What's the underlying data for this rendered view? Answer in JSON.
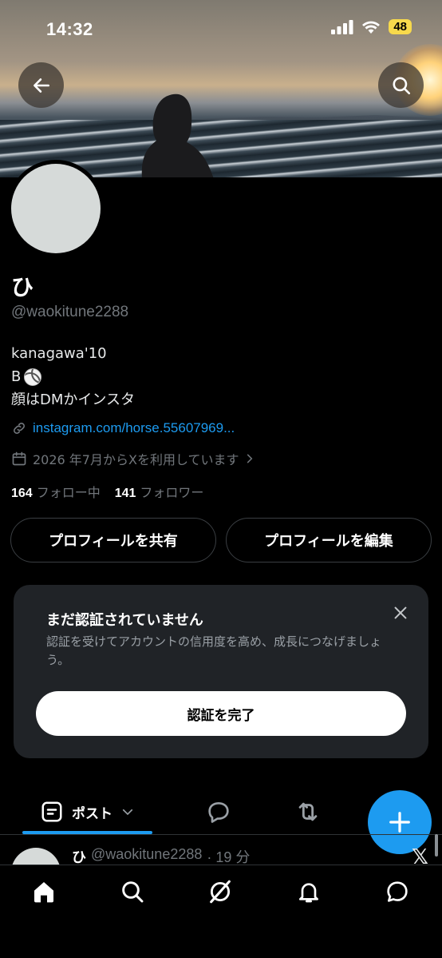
{
  "status_bar": {
    "time": "14:32",
    "battery": "48"
  },
  "profile": {
    "name": "ひ",
    "handle": "@waokitune2288",
    "bio_lines": [
      "kanagawa'10",
      "B",
      "顔はDMかインスタ"
    ],
    "link": "instagram.com/horse.55607969...",
    "joined": "2026 年7月からXを利用しています",
    "following_count": "164",
    "following_label": "フォロー中",
    "followers_count": "141",
    "followers_label": "フォロワー"
  },
  "buttons": {
    "share_profile": "プロフィールを共有",
    "edit_profile": "プロフィールを編集"
  },
  "verify_card": {
    "title": "まだ認証されていません",
    "body": "認証を受けてアカウントの信用度を高め、成長につなげましょう。",
    "cta": "認証を完了"
  },
  "tabs": {
    "posts_label": "ポスト"
  },
  "post_preview": {
    "name": "ひ",
    "handle": "@waokitune2288",
    "time": "· 19 分"
  },
  "icons": [
    "back-arrow-icon",
    "search-icon",
    "link-icon",
    "calendar-icon",
    "chevron-right-icon",
    "close-icon",
    "posts-icon",
    "chevron-down-icon",
    "reply-icon",
    "repost-icon",
    "plus-icon",
    "home-icon",
    "grok-icon",
    "bell-icon",
    "chat-icon"
  ],
  "colors": {
    "accent": "#1d9bf0",
    "background": "#000000",
    "card": "#202327",
    "muted": "#71767b"
  }
}
